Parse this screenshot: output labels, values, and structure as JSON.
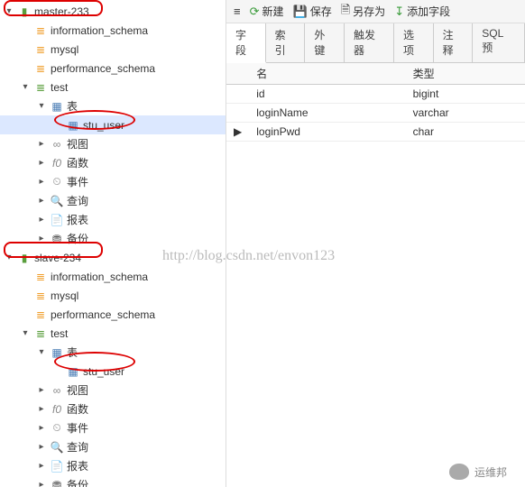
{
  "toolbar": {
    "menu": "≡",
    "new": "新建",
    "save": "保存",
    "saveas": "另存为",
    "addfield": "添加字段"
  },
  "tabs": [
    "字段",
    "索引",
    "外键",
    "触发器",
    "选项",
    "注释",
    "SQL 预"
  ],
  "table": {
    "headers": {
      "name": "名",
      "type": "类型"
    },
    "rows": [
      {
        "name": "id",
        "type": "bigint",
        "current": false
      },
      {
        "name": "loginName",
        "type": "varchar",
        "current": false
      },
      {
        "name": "loginPwd",
        "type": "char",
        "current": true
      }
    ]
  },
  "tree": {
    "master": "master-233",
    "slave": "slave-234",
    "dbs": {
      "info": "information_schema",
      "mysql": "mysql",
      "perf": "performance_schema",
      "test": "test"
    },
    "nodes": {
      "tables": "表",
      "views": "视图",
      "funcs": "函数",
      "events": "事件",
      "queries": "查询",
      "reports": "报表",
      "backup": "备份"
    },
    "table_name": "stu_user"
  },
  "watermark": "http://blog.csdn.net/envon123",
  "footer": "运维邦"
}
